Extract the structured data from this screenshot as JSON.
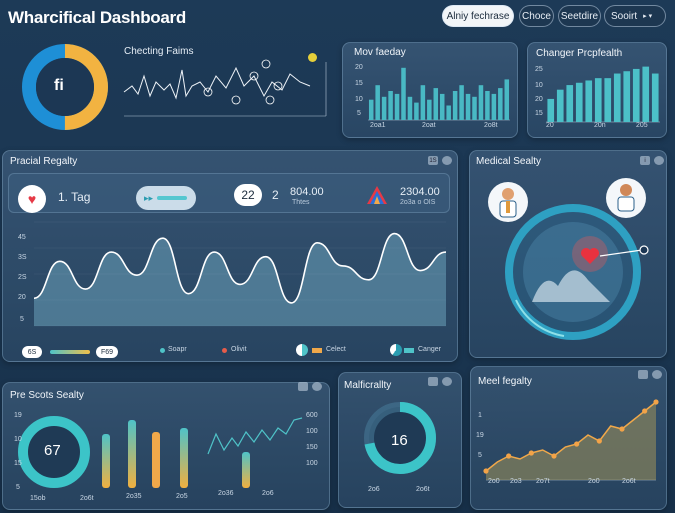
{
  "header": {
    "title": "Wharcifical Dashboard",
    "buttons": [
      "Alniy fechrase",
      "Choce",
      "Seetdire",
      "Sooirt"
    ],
    "dropdown_icon": "chevron-down-icon"
  },
  "ring_top": {
    "center_label": "fi"
  },
  "checking": {
    "title": "Checting Faims"
  },
  "mov_panel": {
    "title": "Mov faeday",
    "xlabels": [
      "2oa1",
      "2oat",
      "2o8t"
    ],
    "ylabels": [
      "20",
      "15",
      "10",
      "5"
    ]
  },
  "change_panel": {
    "title": "Changer Prcpfealth",
    "xlabels": [
      "20",
      "20n",
      "205"
    ],
    "ylabels": [
      "25",
      "10",
      "20",
      "15"
    ]
  },
  "pracial": {
    "title": "Pracial Regalty",
    "tag_label": "1. Tag",
    "stat_value": "22",
    "stat_num": "2",
    "stat_big": "804.00",
    "stat_sub": "Thtes",
    "stat2_big": "2304.00",
    "stat2_sub": "2o3a o OIS",
    "ylabels": [
      "45",
      "3S",
      "2S",
      "20",
      "5"
    ],
    "legend": [
      "Soapr",
      "Olivit",
      "Celect",
      "Canger"
    ],
    "badge_left": "6S",
    "badge_mid": "F69",
    "corner_icon": "1S"
  },
  "medical": {
    "title": "Medical Sealty",
    "corner_icon": "i"
  },
  "pre_scots": {
    "title": "Pre Scots Sealty",
    "ring_value": "67",
    "ylabels": [
      "19",
      "10",
      "15",
      "5"
    ],
    "y2labels": [
      "600",
      "100",
      "150",
      "100"
    ],
    "xlabels": [
      "15ob",
      "2o6t",
      "2o35",
      "2o5",
      "2o36",
      "2o6"
    ]
  },
  "malfic": {
    "title": "Malficrallty",
    "ring_value": "16",
    "ring_fraction": 0.72,
    "xlabels": [
      "2o6",
      "2o6t"
    ]
  },
  "meel": {
    "title": "Meel fegalty",
    "xlabels": [
      "2o0",
      "2o3",
      "2o7t",
      "2o0",
      "2o6t"
    ],
    "ylabels": [
      "1",
      "19",
      "5"
    ]
  },
  "colors": {
    "teal": "#4fc3c8",
    "accent": "#f0a84a",
    "red": "#e63946",
    "blue": "#1e90d8"
  },
  "chart_data": [
    {
      "type": "bar",
      "title": "Mov faeday",
      "values": [
        7,
        12,
        8,
        10,
        9,
        18,
        8,
        6,
        12,
        7,
        11,
        9,
        5,
        10,
        12,
        9,
        8,
        12,
        10,
        9,
        11,
        14
      ],
      "ylim": [
        0,
        20
      ]
    },
    {
      "type": "bar",
      "title": "Changer Prcpfealth",
      "values": [
        10,
        14,
        16,
        17,
        18,
        19,
        19,
        21,
        22,
        23,
        24,
        21
      ],
      "ylim": [
        0,
        26
      ]
    },
    {
      "type": "area",
      "title": "Pracial Regalty",
      "values": [
        12,
        28,
        16,
        32,
        22,
        38,
        14,
        32,
        18,
        30,
        10,
        36,
        26,
        20,
        40,
        24,
        32
      ],
      "ylim": [
        0,
        45
      ]
    },
    {
      "type": "line",
      "title": "Meel fegalty",
      "values": [
        3,
        6,
        8,
        7,
        9,
        10,
        8,
        11,
        12,
        15,
        13,
        18,
        17,
        20,
        23,
        26
      ],
      "ylim": [
        0,
        30
      ]
    }
  ]
}
